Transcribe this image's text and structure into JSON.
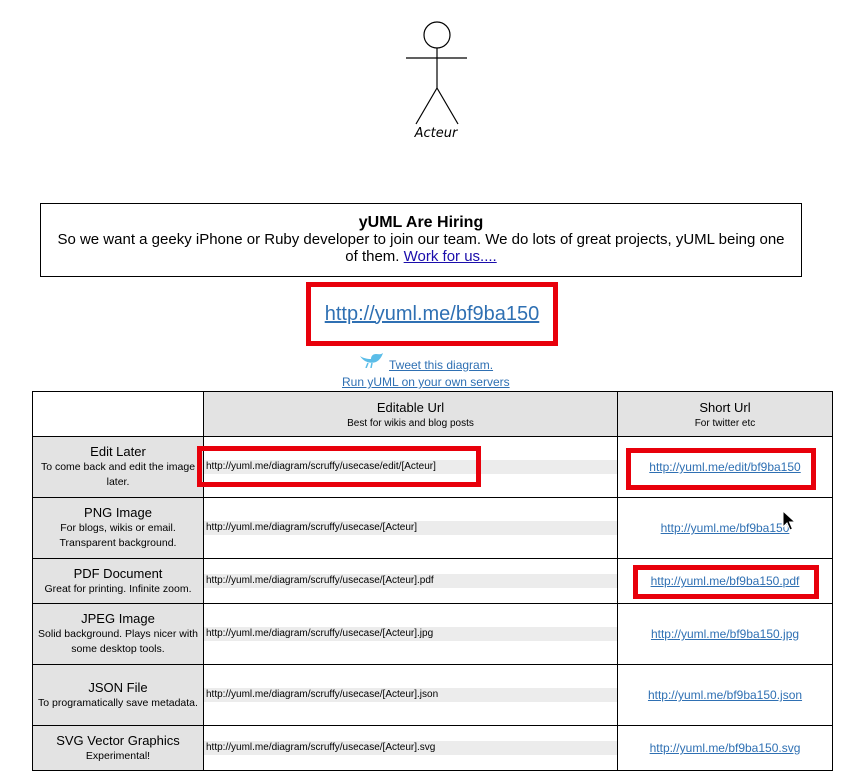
{
  "diagram": {
    "actor_label": "Acteur"
  },
  "hiring": {
    "title": "yUML Are Hiring",
    "body": "So we want a geeky iPhone or Ruby developer to join our team. We do lots of great projects, yUML being one of them.",
    "link_label": "Work for us...."
  },
  "short_url": "http://yuml.me/bf9ba150",
  "tweet_label": "Tweet this diagram.",
  "run_label": "Run yUML on your own servers",
  "table": {
    "col_editable": {
      "title": "Editable Url",
      "subtitle": "Best for wikis and blog posts"
    },
    "col_short": {
      "title": "Short Url",
      "subtitle": "For twitter etc"
    },
    "rows": [
      {
        "title": "Edit Later",
        "desc": "To come back and edit the image later.",
        "url": "http://yuml.me/diagram/scruffy/usecase/edit/[Acteur]",
        "short": "http://yuml.me/edit/bf9ba150"
      },
      {
        "title": "PNG Image",
        "desc": "For blogs, wikis or email. Transparent background.",
        "url": "http://yuml.me/diagram/scruffy/usecase/[Acteur]",
        "short": "http://yuml.me/bf9ba150"
      },
      {
        "title": "PDF Document",
        "desc": "Great for printing. Infinite zoom.",
        "url": "http://yuml.me/diagram/scruffy/usecase/[Acteur].pdf",
        "short": "http://yuml.me/bf9ba150.pdf"
      },
      {
        "title": "JPEG Image",
        "desc": "Solid background. Plays nicer with some desktop tools.",
        "url": "http://yuml.me/diagram/scruffy/usecase/[Acteur].jpg",
        "short": "http://yuml.me/bf9ba150.jpg"
      },
      {
        "title": "JSON File",
        "desc": "To programatically save metadata.",
        "url": "http://yuml.me/diagram/scruffy/usecase/[Acteur].json",
        "short": "http://yuml.me/bf9ba150.json"
      },
      {
        "title": "SVG Vector Graphics",
        "desc": "Experimental!",
        "url": "http://yuml.me/diagram/scruffy/usecase/[Acteur].svg",
        "short": "http://yuml.me/bf9ba150.svg"
      }
    ]
  },
  "colors": {
    "highlight": "#e8000b",
    "link": "#2f70b3",
    "header_bg": "#e3e3e3"
  }
}
